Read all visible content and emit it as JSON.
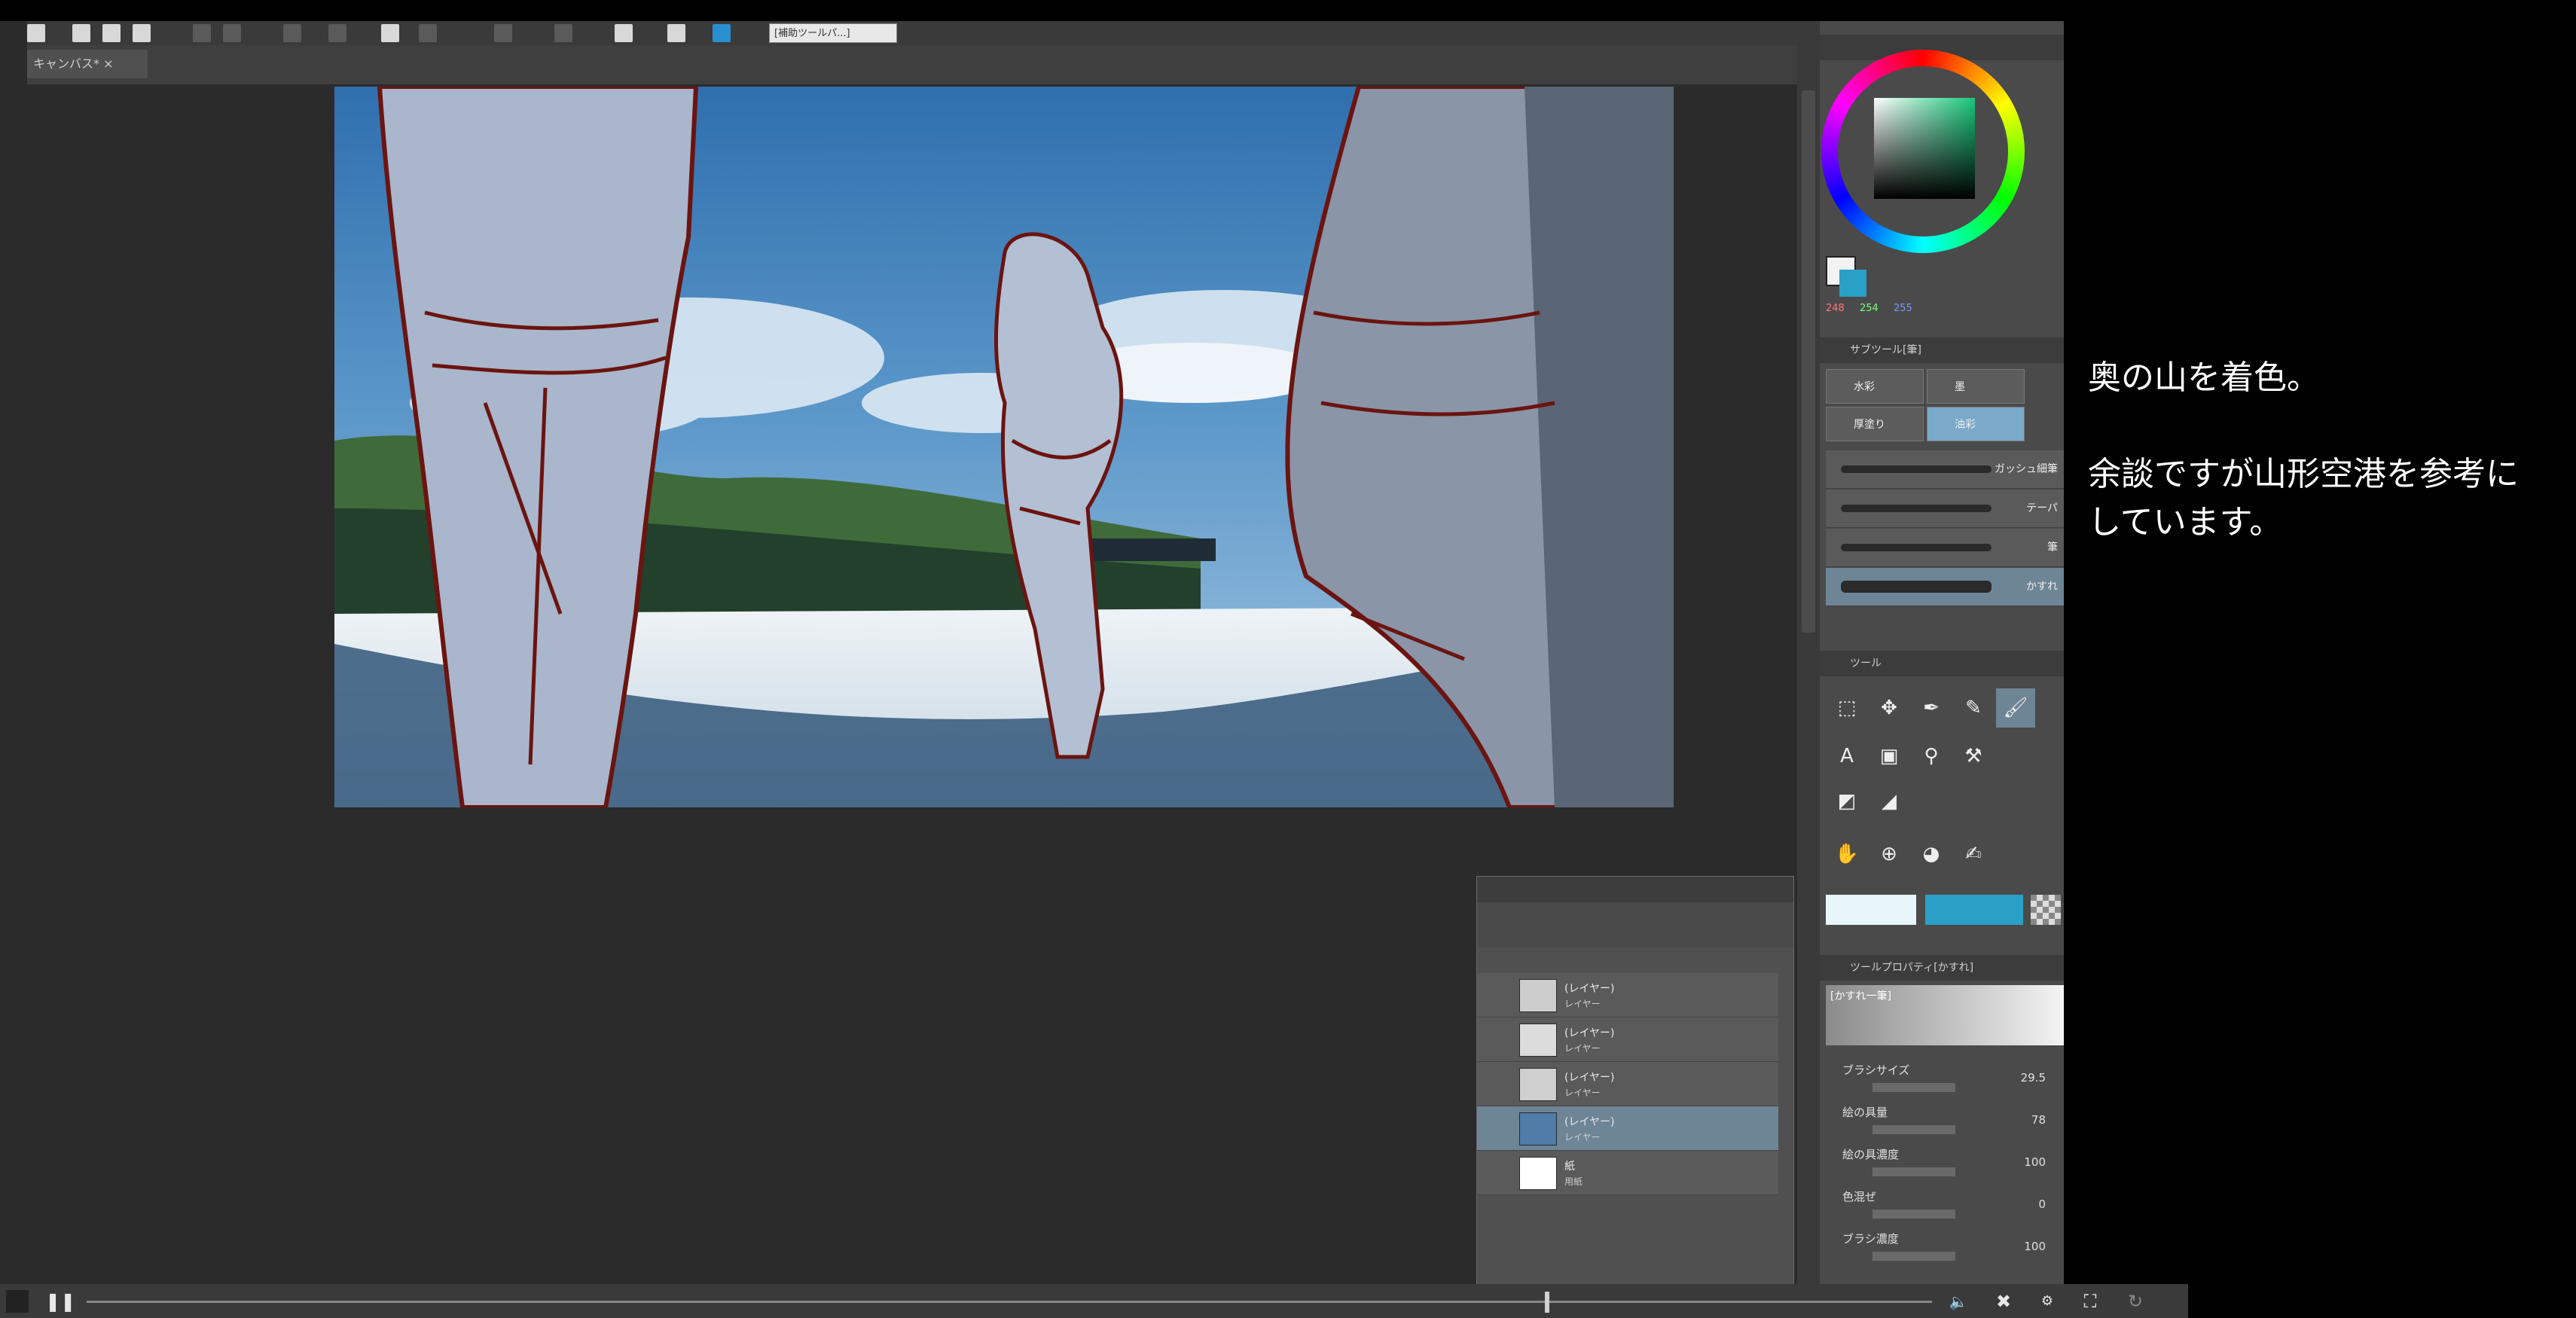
{
  "app": {
    "toolbar_field": "[補助ツールパ...]",
    "document_tab": "キャンバス* ×"
  },
  "layers": [
    {
      "name": "(レイヤー)",
      "mode": "レイヤー",
      "thumb": "#cdcdcd"
    },
    {
      "name": "(レイヤー)",
      "mode": "レイヤー",
      "thumb": "#dcdcdc"
    },
    {
      "name": "(レイヤー)",
      "mode": "レイヤー",
      "thumb": "#cfcfcf"
    },
    {
      "name": "(レイヤー)",
      "mode": "レイヤー",
      "thumb": "#4f7ca8"
    },
    {
      "name": "紙",
      "mode": "用紙",
      "thumb": "#ffffff"
    }
  ],
  "color_panel": {
    "r": "248",
    "g": "254",
    "b": "255"
  },
  "subtool": {
    "header": "サブツール[筆]",
    "tabs": [
      "水彩",
      "墨",
      "厚塗り",
      "油彩"
    ],
    "strokes": [
      "ガッシュ細筆",
      "テーパ",
      "筆",
      "かすれ"
    ]
  },
  "tool": {
    "header": "ツール"
  },
  "tool_property": {
    "header": "ツールプロパティ[かすれ]",
    "brush_name": "[かすれ一筆]",
    "rows": [
      {
        "label": "ブラシサイズ",
        "value": "29.5"
      },
      {
        "label": "絵の具量",
        "value": "78"
      },
      {
        "label": "絵の具濃度",
        "value": "100"
      },
      {
        "label": "色混ぜ",
        "value": "0"
      },
      {
        "label": "ブラシ濃度",
        "value": "100"
      }
    ]
  },
  "caption": "奥の山を着色。\n\n余談ですが山形空港を参考に\nしています。",
  "player": {
    "progress": 0.79
  }
}
